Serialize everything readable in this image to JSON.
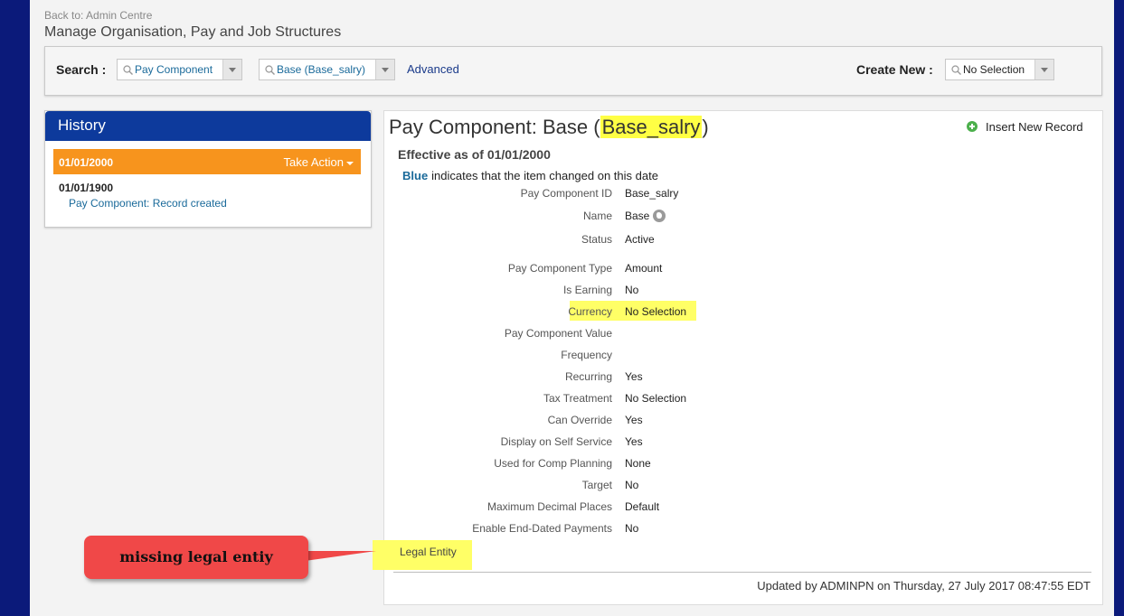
{
  "breadcrumb": {
    "back_label": "Back to: Admin Centre"
  },
  "page_title": "Manage Organisation, Pay and Job Structures",
  "search_bar": {
    "search_label": "Search :",
    "type_selector_value": "Pay Component",
    "record_selector_value": "Base (Base_salry)",
    "advanced_label": "Advanced",
    "create_new_label": "Create New :",
    "create_new_value": "No Selection"
  },
  "history": {
    "title": "History",
    "current": {
      "date": "01/01/2000",
      "action_label": "Take Action"
    },
    "items": [
      {
        "date": "01/01/1900",
        "description": "Pay Component: Record created"
      }
    ]
  },
  "record": {
    "title_prefix": "Pay Component: Base (",
    "title_highlight": "Base_salry",
    "title_suffix": ")",
    "insert_label": "Insert New Record",
    "effective_label": "Effective as of  01/01/2000",
    "legend_keyword": "Blue",
    "legend_text": "indicates that the item changed on this date",
    "fields": [
      {
        "label": "Pay Component ID",
        "value": "Base_salry"
      },
      {
        "label": "Name",
        "value": "Base"
      },
      {
        "label": "Status",
        "value": "Active"
      },
      {
        "label": "Pay Component Type",
        "value": "Amount"
      },
      {
        "label": "Is Earning",
        "value": "No"
      },
      {
        "label": "Currency",
        "value": "No Selection"
      },
      {
        "label": "Pay Component Value",
        "value": ""
      },
      {
        "label": "Frequency",
        "value": ""
      },
      {
        "label": "Recurring",
        "value": "Yes"
      },
      {
        "label": "Tax Treatment",
        "value": "No Selection"
      },
      {
        "label": "Can Override",
        "value": "Yes"
      },
      {
        "label": "Display on Self Service",
        "value": "Yes"
      },
      {
        "label": "Used for Comp Planning",
        "value": "None"
      },
      {
        "label": "Target",
        "value": "No"
      },
      {
        "label": "Maximum Decimal Places",
        "value": "Default"
      },
      {
        "label": "Enable End-Dated Payments",
        "value": "No"
      }
    ],
    "legal_entity_label": "Legal Entity",
    "updated_text": "Updated by ADMINPN on Thursday, 27 July 2017 08:47:55 EDT"
  },
  "annotation": {
    "callout_text": "missing legal entiy"
  },
  "colors": {
    "highlight": "#ffff66",
    "history_header": "#0d3a9c",
    "current_row": "#f7941d",
    "callout": "#f04848"
  }
}
